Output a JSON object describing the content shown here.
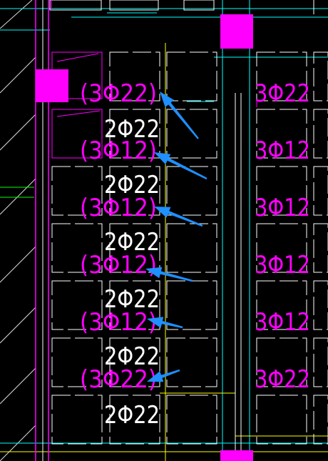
{
  "drawing": {
    "colors": {
      "background": "#000000",
      "magenta": "#ff00ff",
      "white": "#ffffff",
      "cyan": "#00ffff",
      "yellow": "#ffff00",
      "green": "#00ff00",
      "arrow": "#1e90ff"
    },
    "left_labels": [
      {
        "text": "(3Φ22)",
        "color": "magenta"
      },
      {
        "text": "2Φ22",
        "color": "white"
      },
      {
        "text": "(3Φ12)",
        "color": "magenta"
      },
      {
        "text": "2Φ22",
        "color": "white"
      },
      {
        "text": "(3Φ12)",
        "color": "magenta"
      },
      {
        "text": "2Φ22",
        "color": "white"
      },
      {
        "text": "(3Φ12)",
        "color": "magenta"
      },
      {
        "text": "2Φ22",
        "color": "white"
      },
      {
        "text": "(3Φ12)",
        "color": "magenta"
      },
      {
        "text": "2Φ22",
        "color": "white"
      },
      {
        "text": "(3Φ22)",
        "color": "magenta"
      },
      {
        "text": "2Φ22",
        "color": "white"
      }
    ],
    "right_labels": [
      {
        "text": "3Φ22",
        "color": "magenta"
      },
      {
        "text": "3Φ12",
        "color": "magenta"
      },
      {
        "text": "3Φ12",
        "color": "magenta"
      },
      {
        "text": "3Φ12",
        "color": "magenta"
      },
      {
        "text": "3Φ12",
        "color": "magenta"
      },
      {
        "text": "3Φ22",
        "color": "magenta"
      }
    ],
    "arrow_count": 6
  }
}
